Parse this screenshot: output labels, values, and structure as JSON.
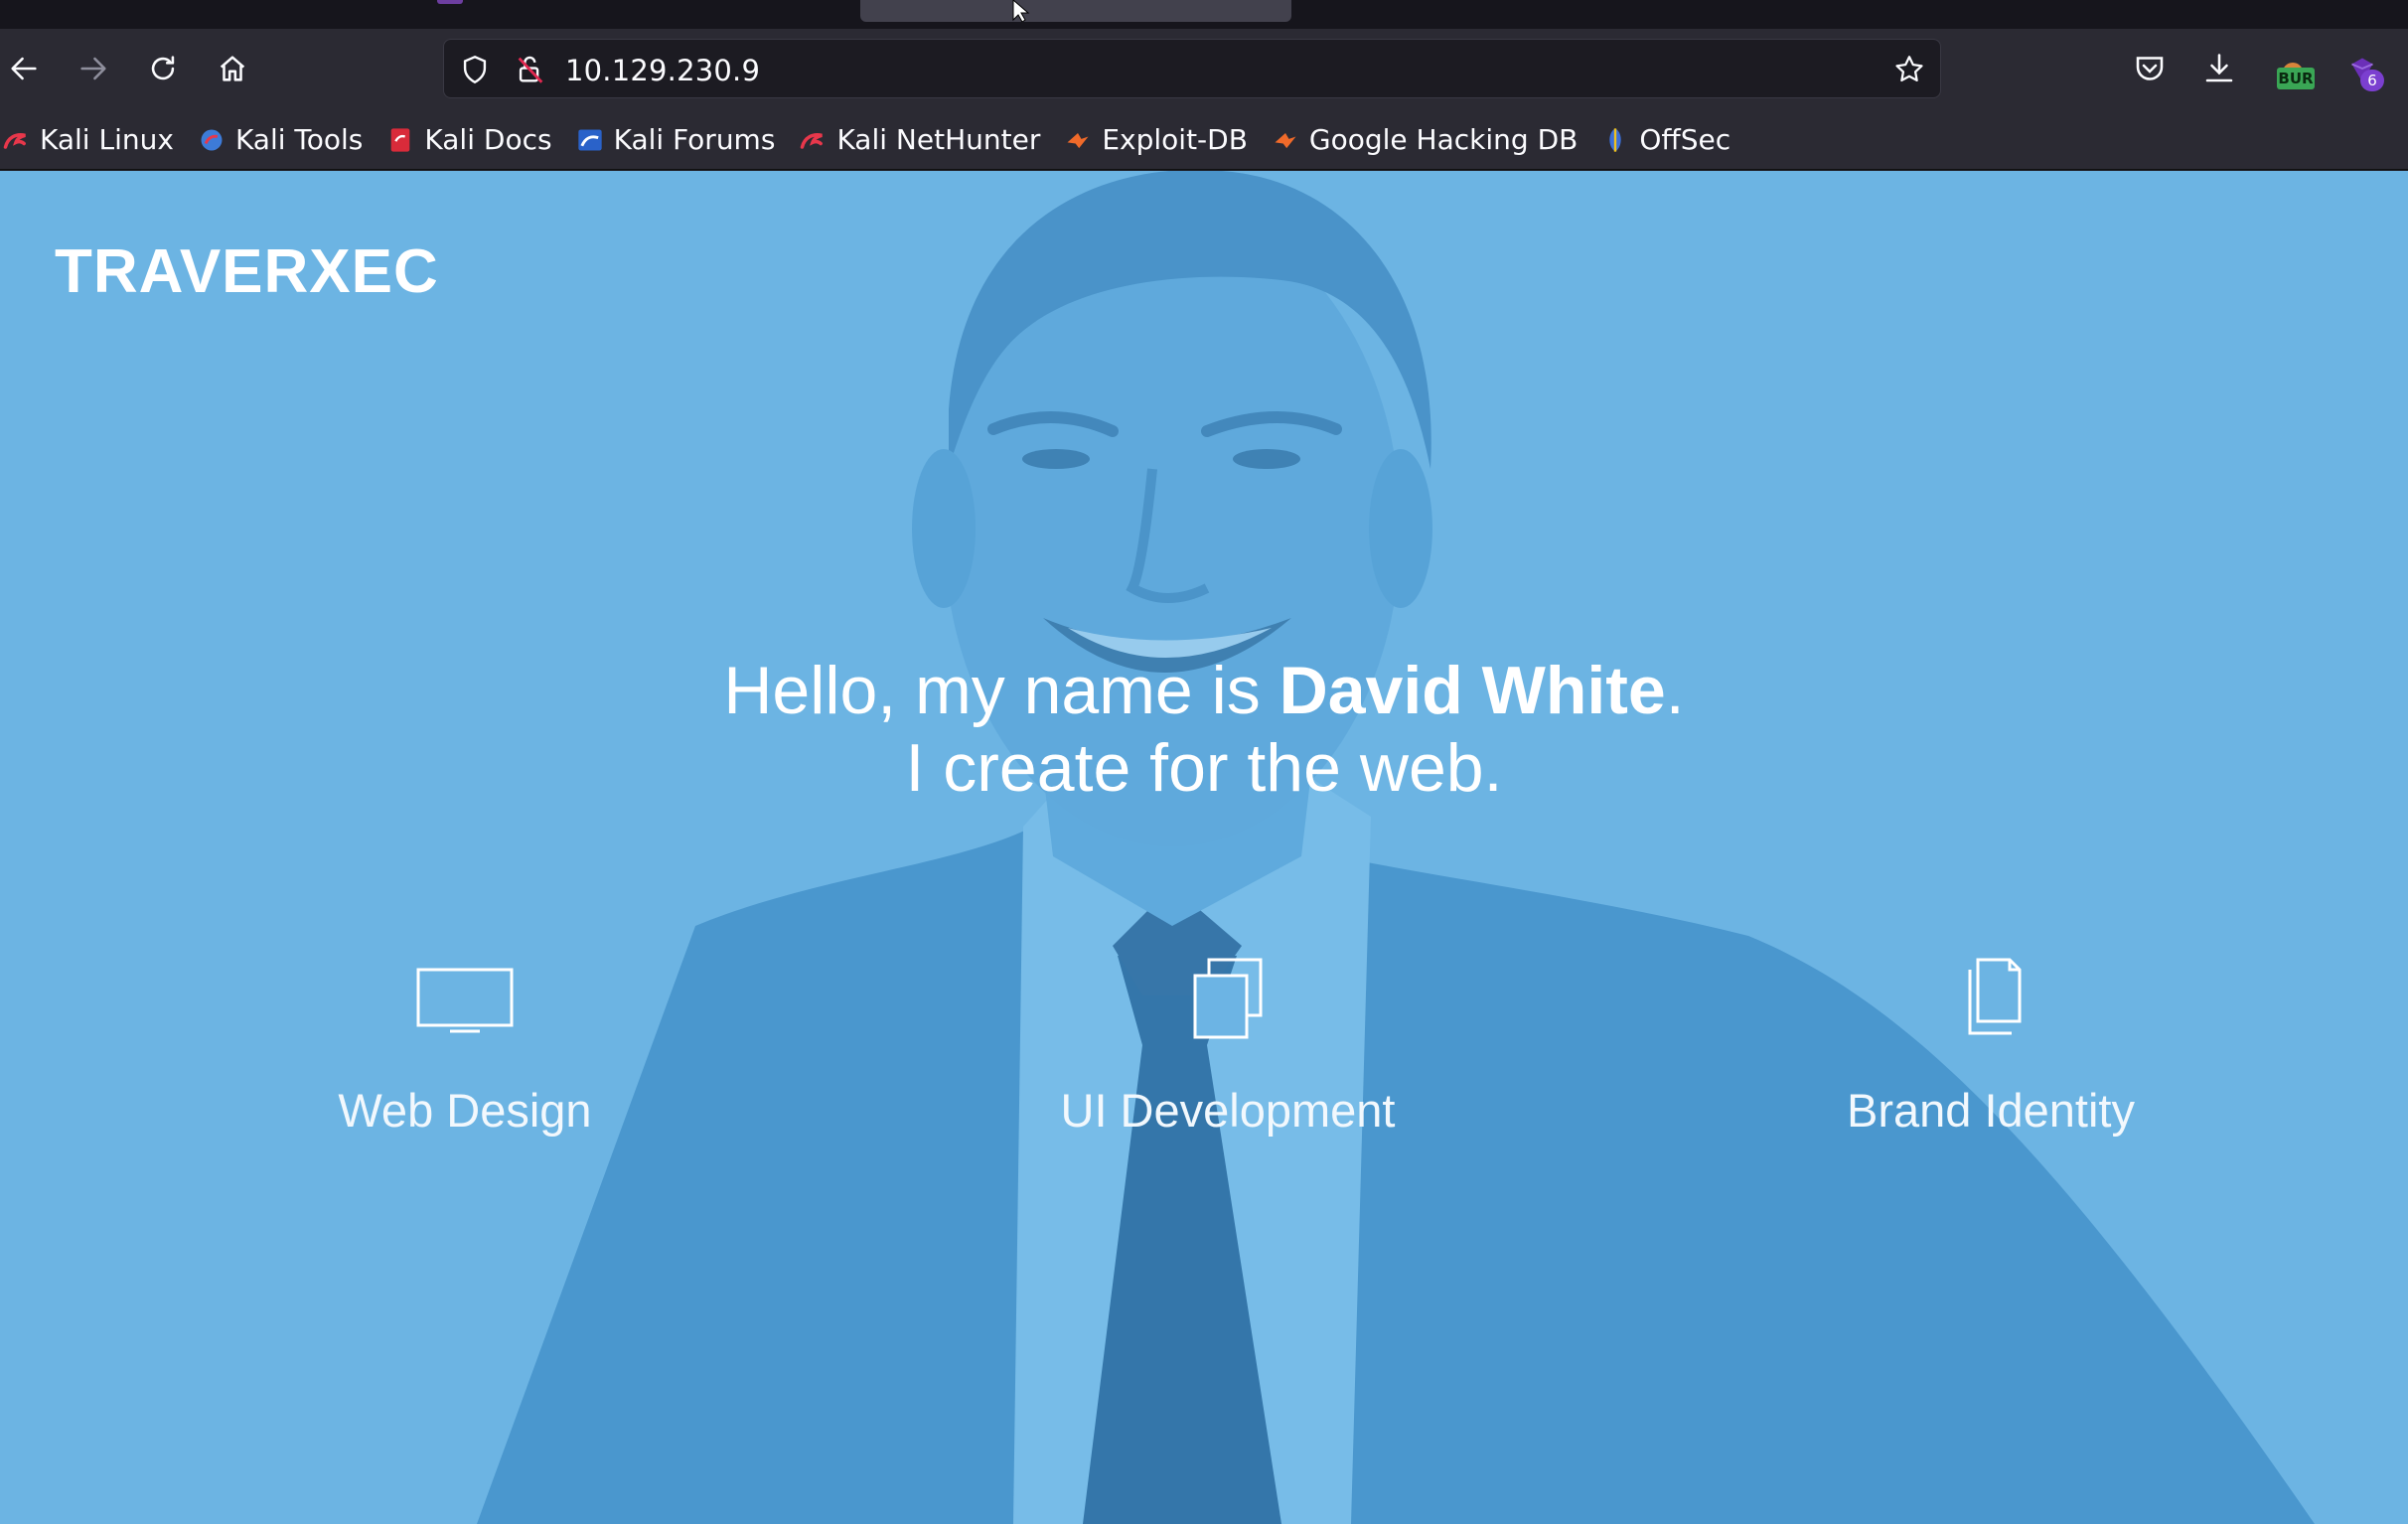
{
  "browser": {
    "url": "10.129.230.9",
    "extension_badges": {
      "burp": "BUR",
      "count": "6"
    }
  },
  "bookmarks": [
    {
      "label": "Kali Linux",
      "icon": "kali-icon"
    },
    {
      "label": "Kali Tools",
      "icon": "kali-tools-icon"
    },
    {
      "label": "Kali Docs",
      "icon": "kali-docs-icon"
    },
    {
      "label": "Kali Forums",
      "icon": "kali-forums-icon"
    },
    {
      "label": "Kali NetHunter",
      "icon": "kali-icon"
    },
    {
      "label": "Exploit-DB",
      "icon": "exploit-db-icon"
    },
    {
      "label": "Google Hacking DB",
      "icon": "exploit-db-icon"
    },
    {
      "label": "OffSec",
      "icon": "offsec-icon"
    }
  ],
  "site": {
    "logo": "TRAVERXEC",
    "hero": {
      "greeting": "Hello, my name is ",
      "name": "David White",
      "period": ".",
      "tagline": "I create for the web."
    },
    "services": [
      {
        "label": "Web Design",
        "icon": "monitor-icon"
      },
      {
        "label": "UI Development",
        "icon": "stacked-windows-icon"
      },
      {
        "label": "Brand Identity",
        "icon": "documents-icon"
      }
    ]
  },
  "colors": {
    "page_background": "#6cb4e4",
    "toolbar": "#2b2a33",
    "url_field": "#1c1b22"
  }
}
